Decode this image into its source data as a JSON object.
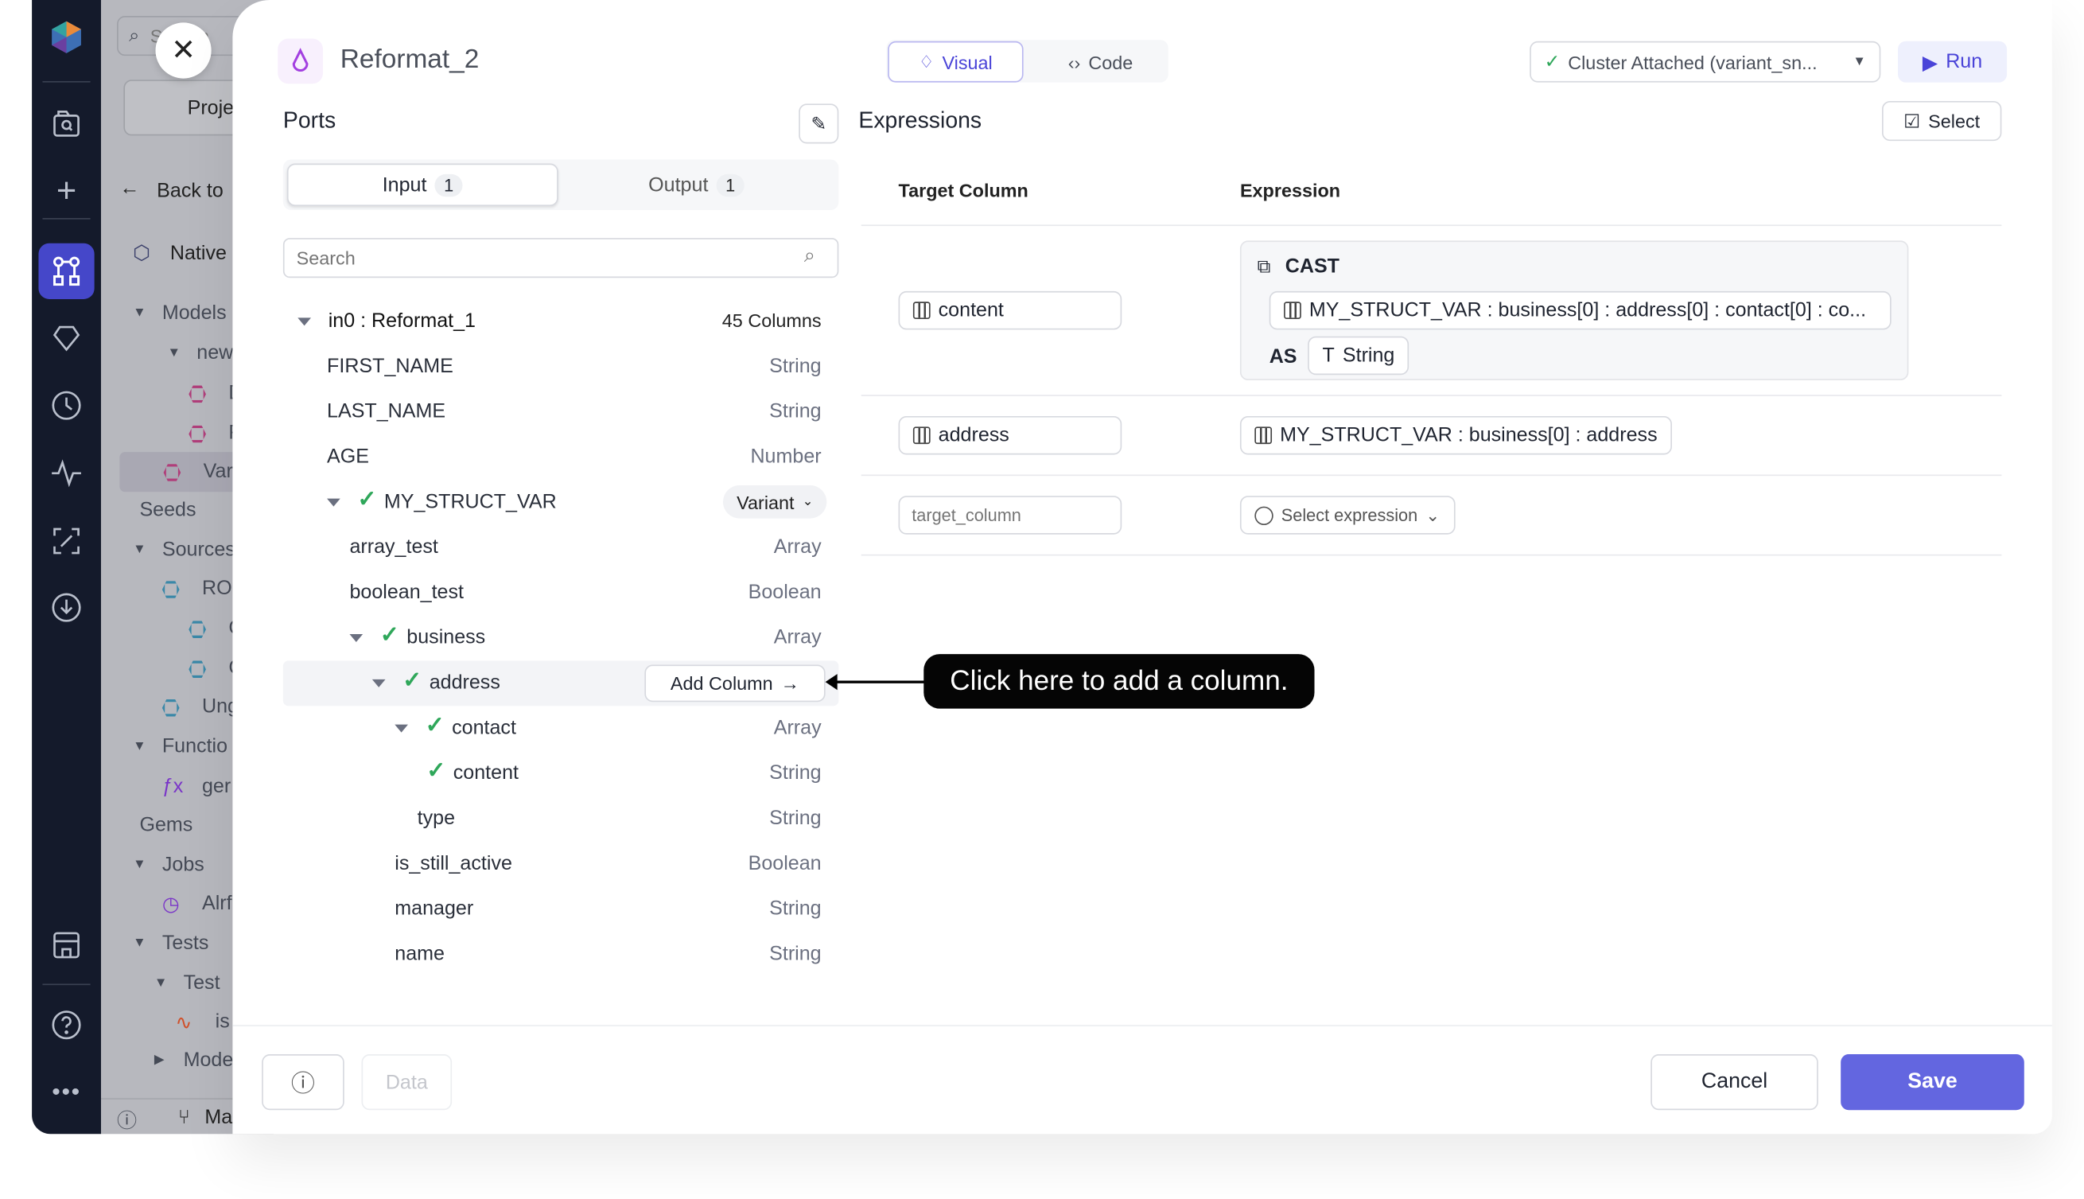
{
  "app": {
    "brand_colors": {
      "nav_bg": "#141a2b",
      "accent": "#6366e0",
      "check": "#2fa75a",
      "active_nav": "#4547c9"
    }
  },
  "nav": {
    "icons": [
      "logo-icon",
      "search-folder-icon",
      "plus-icon",
      "pipeline-icon",
      "gem-icon",
      "clock-icon",
      "activity-icon",
      "transform-icon",
      "download-icon",
      "store-icon",
      "help-icon",
      "more-icon"
    ]
  },
  "background_panel": {
    "search_placeholder": "Search",
    "project_button": "Proje",
    "back_label": "Back to",
    "native_label": "Native",
    "items": [
      "Models",
      "new",
      "D",
      "F",
      "Var",
      "Seeds",
      "Sources",
      "ROI",
      "C",
      "C",
      "Ung",
      "Functio",
      "ger",
      "Gems",
      "Jobs",
      "Alrf",
      "Tests",
      "Test",
      "is",
      "Mode"
    ],
    "footer_branch": "Ma"
  },
  "header": {
    "title": "Reformat_2",
    "tabs": [
      {
        "label": "Visual",
        "active": true
      },
      {
        "label": "Code",
        "active": false
      }
    ],
    "cluster": "Cluster Attached (variant_sn...",
    "run_label": "Run"
  },
  "ports": {
    "title": "Ports",
    "tabs": [
      {
        "label": "Input",
        "count": "1",
        "active": true
      },
      {
        "label": "Output",
        "count": "1",
        "active": false
      }
    ],
    "search_placeholder": "Search",
    "source": {
      "name": "in0 : Reformat_1",
      "columns": "45 Columns"
    },
    "rows": [
      {
        "name": "FIRST_NAME",
        "type": "String",
        "depth": 1
      },
      {
        "name": "LAST_NAME",
        "type": "String",
        "depth": 1
      },
      {
        "name": "AGE",
        "type": "Number",
        "depth": 1
      },
      {
        "name": "MY_STRUCT_VAR",
        "type": "Variant",
        "depth": 1,
        "expanded": true,
        "checked": true,
        "dropdown": true
      },
      {
        "name": "array_test",
        "type": "Array",
        "depth": 2
      },
      {
        "name": "boolean_test",
        "type": "Boolean",
        "depth": 2
      },
      {
        "name": "business",
        "type": "Array",
        "depth": 2,
        "expanded": true,
        "checked": true
      },
      {
        "name": "address",
        "type": "",
        "depth": 3,
        "expanded": true,
        "checked": true,
        "hovered": true
      },
      {
        "name": "contact",
        "type": "Array",
        "depth": 4,
        "expanded": true,
        "checked": true
      },
      {
        "name": "content",
        "type": "String",
        "depth": 5,
        "checked": true
      },
      {
        "name": "type",
        "type": "String",
        "depth": 5
      },
      {
        "name": "is_still_active",
        "type": "Boolean",
        "depth": 4
      },
      {
        "name": "manager",
        "type": "String",
        "depth": 4
      },
      {
        "name": "name",
        "type": "String",
        "depth": 4
      }
    ],
    "add_column_label": "Add Column"
  },
  "tooltip": "Click here to add a column.",
  "expressions": {
    "title": "Expressions",
    "select_label": "Select",
    "headers": {
      "target": "Target Column",
      "expression": "Expression"
    },
    "rows": [
      {
        "target": "content",
        "function": "CAST",
        "arg": "MY_STRUCT_VAR : business[0] : address[0] : contact[0] : co...",
        "as": "AS",
        "as_type": "String"
      },
      {
        "target": "address",
        "expression": "MY_STRUCT_VAR : business[0] : address"
      }
    ],
    "new_row": {
      "target_placeholder": "target_column",
      "expression_placeholder": "Select expression"
    }
  },
  "footer": {
    "data_label": "Data",
    "cancel_label": "Cancel",
    "save_label": "Save"
  }
}
